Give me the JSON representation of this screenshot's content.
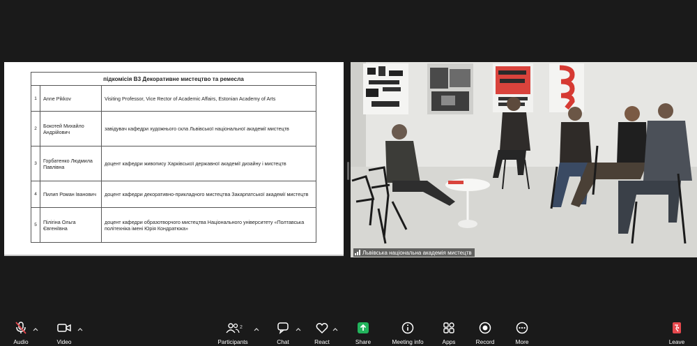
{
  "shared_document": {
    "table_title": "підкомісія В3 Декоративне мистецтво та ремесла",
    "rows": [
      {
        "num": "1",
        "name": "Anne Pikkov",
        "role": "Visiting Professor, Vice Rector of Academic Affairs, Estonian Academy of Arts"
      },
      {
        "num": "2",
        "name": "Бокотей Михайло Андрійович",
        "role": "завідувач кафедри художнього скла Львівської національної академії мистецтв"
      },
      {
        "num": "3",
        "name": "Горбатенко Людмила Павлівна",
        "role": "доцент кафедри живопису Харківської державної академії дизайну і мистецтв"
      },
      {
        "num": "4",
        "name": "Пилип Роман Іванович",
        "role": "доцент кафедри декоративно-прикладного мистецтва Закарпатської академії мистецтв"
      },
      {
        "num": "5",
        "name": "Пілігіна Ольга Євгеніївна",
        "role": "доцент кафедри образотворчого мистецтва Національного університету «Полтавська політехніка імені Юрія Кондратюка»"
      }
    ]
  },
  "video": {
    "participant_name": "Львівська національна академія мистецтв"
  },
  "toolbar": {
    "audio": "Audio",
    "video": "Video",
    "participants": "Participants",
    "participants_count": "2",
    "chat": "Chat",
    "react": "React",
    "share": "Share",
    "meeting_info": "Meeting info",
    "apps": "Apps",
    "record": "Record",
    "more": "More",
    "leave": "Leave"
  },
  "colors": {
    "share_green": "#22b35c",
    "leave_red": "#e5484d",
    "background": "#1a1a1a"
  }
}
